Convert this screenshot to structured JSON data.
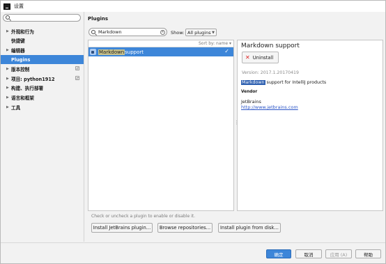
{
  "window": {
    "title": "设置"
  },
  "left": {
    "search_placeholder": "",
    "items": [
      {
        "label": "外观和行为",
        "expandable": true,
        "settings": false
      },
      {
        "label": "快捷键",
        "expandable": false,
        "settings": false
      },
      {
        "label": "编辑器",
        "expandable": true,
        "settings": false
      },
      {
        "label": "Plugins",
        "expandable": false,
        "settings": false,
        "selected": true
      },
      {
        "label": "版本控制",
        "expandable": true,
        "settings": true
      },
      {
        "label": "项目: python1912",
        "expandable": true,
        "settings": true
      },
      {
        "label": "构建、执行部署",
        "expandable": true,
        "settings": false
      },
      {
        "label": "语言和框架",
        "expandable": true,
        "settings": false
      },
      {
        "label": "工具",
        "expandable": true,
        "settings": false
      }
    ]
  },
  "plugins": {
    "heading": "Plugins",
    "search_value": "Markdown",
    "show_label": "Show:",
    "show_value": "All plugins",
    "sort_label": "Sort by: name ▾",
    "rows": [
      {
        "match": "Markdown",
        "rest": " support",
        "enabled": true
      }
    ],
    "hint": "Check or uncheck a plugin to enable or disable it.",
    "install_jetbrains": "Install JetBrains plugin...",
    "browse": "Browse repositories...",
    "install_disk": "Install plugin from disk..."
  },
  "detail": {
    "title": "Markdown support",
    "uninstall": "Uninstall",
    "version": "Version: 2017.1.20170419",
    "desc_match": "Markdown",
    "desc_rest": " support for IntelliJ products",
    "vendor_heading": "Vendor",
    "vendor_name": "JetBrains",
    "vendor_url": "http://www.jetbrains.com"
  },
  "footer": {
    "ok": "确定",
    "cancel": "取消",
    "apply": "应用 (A)",
    "help": "帮助"
  },
  "colors": {
    "selection": "#3d86d9",
    "link": "#2b55c8",
    "match_highlight": "#c9c38d"
  }
}
